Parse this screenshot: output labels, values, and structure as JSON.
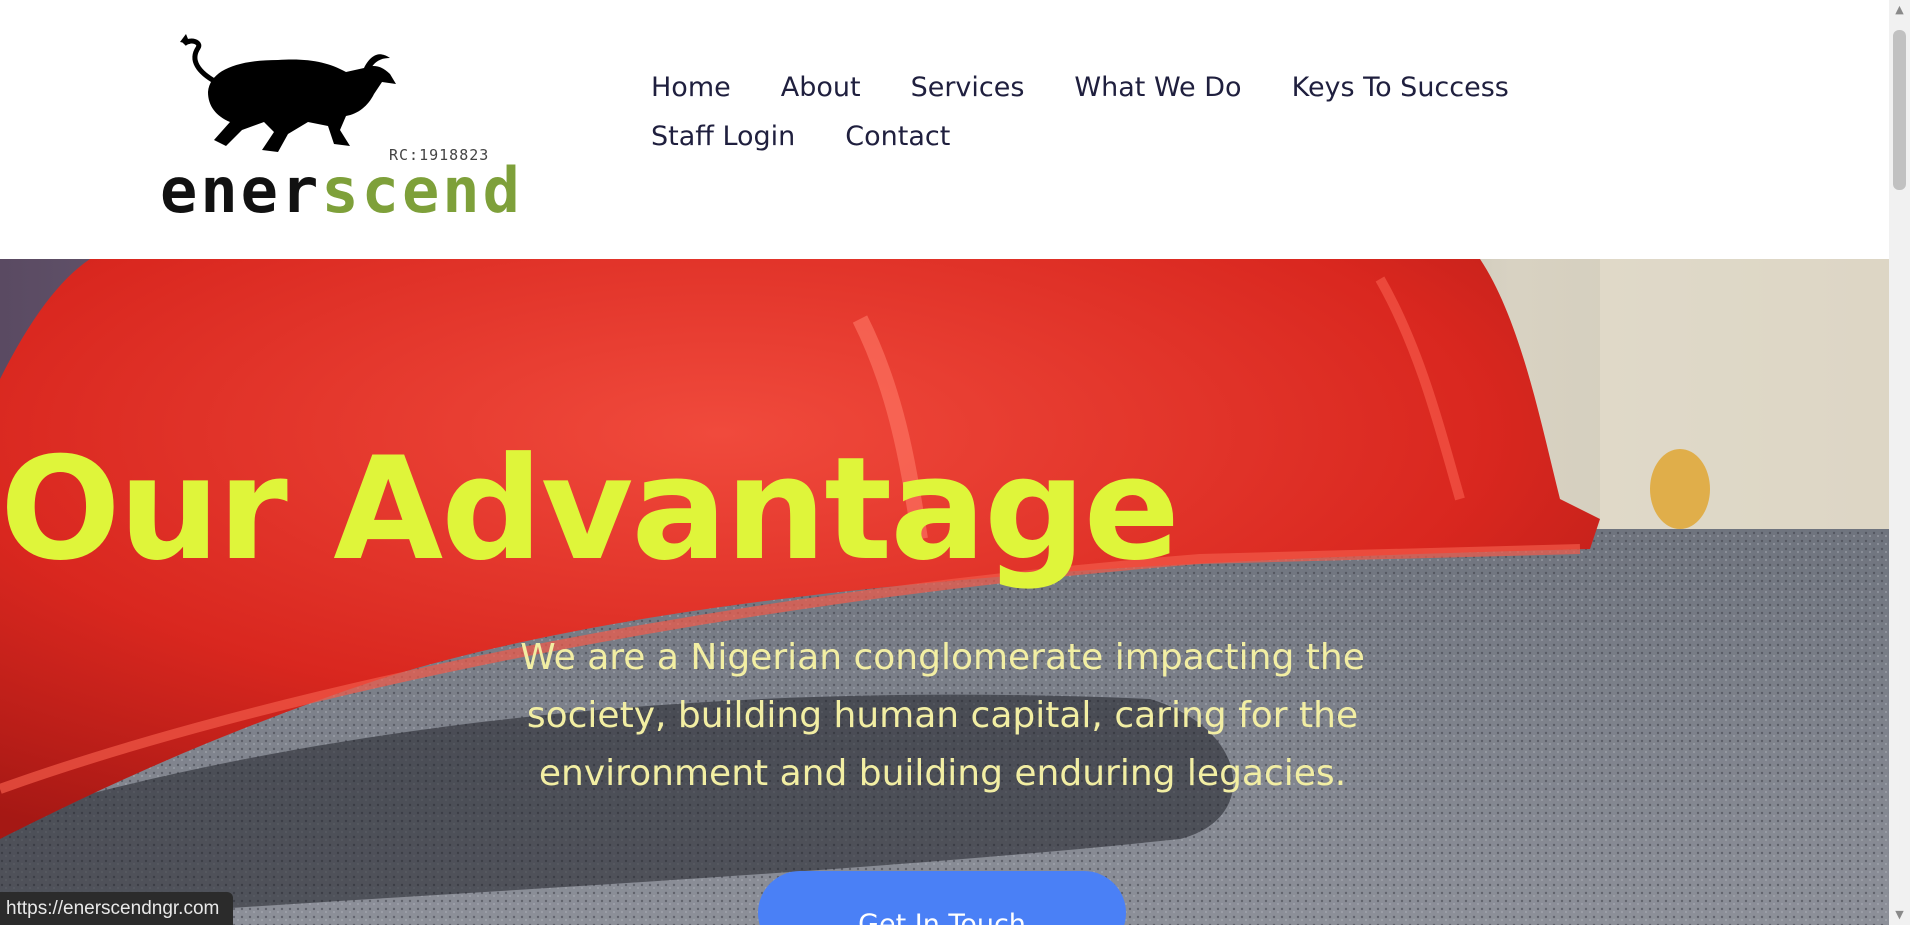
{
  "logo": {
    "rc_number": "RC:1918823",
    "wordmark_part1": "ener",
    "wordmark_part2": "scend",
    "wordmark_colors": [
      "#111111",
      "#7ea03a"
    ],
    "icon": "charging-bull-icon"
  },
  "nav": {
    "items": [
      "Home",
      "About",
      "Services",
      "What We Do",
      "Keys To Success",
      "Staff Login",
      "Contact"
    ]
  },
  "hero": {
    "title": "Our Advantage",
    "subtitle": "We are a Nigerian conglomerate impacting the society, building human capital, caring for the environment and building enduring legacies.",
    "cta_label": "Get In Touch",
    "title_color": "#dff53a",
    "cta_color": "#4a80f6"
  },
  "status_bar": {
    "url": "https://enerscendngr.com"
  }
}
